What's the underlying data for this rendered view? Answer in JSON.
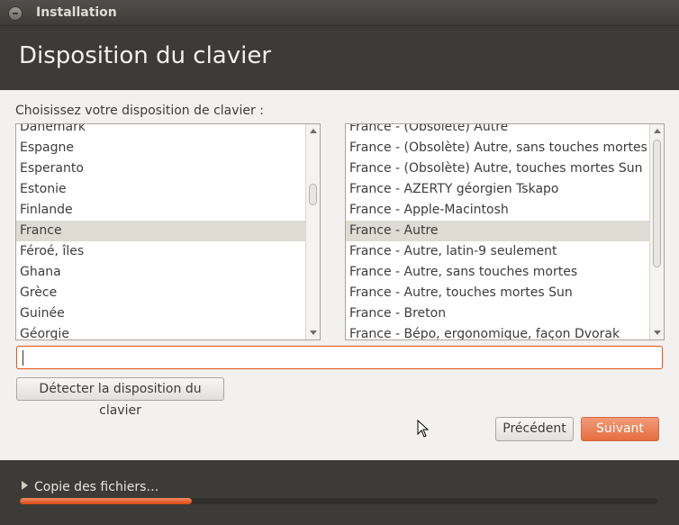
{
  "window": {
    "title": "Installation"
  },
  "header": {
    "title": "Disposition du clavier"
  },
  "prompt": "Choisissez votre disposition de clavier :",
  "layouts": [
    {
      "label": "Danemark",
      "selected": false
    },
    {
      "label": "Espagne",
      "selected": false
    },
    {
      "label": "Esperanto",
      "selected": false
    },
    {
      "label": "Estonie",
      "selected": false
    },
    {
      "label": "Finlande",
      "selected": false
    },
    {
      "label": "France",
      "selected": true
    },
    {
      "label": "Féroé, îles",
      "selected": false
    },
    {
      "label": "Ghana",
      "selected": false
    },
    {
      "label": "Grèce",
      "selected": false
    },
    {
      "label": "Guinée",
      "selected": false
    },
    {
      "label": "Géorgie",
      "selected": false
    }
  ],
  "variants": [
    {
      "label": "France - (Obsolète) Autre",
      "selected": false
    },
    {
      "label": "France - (Obsolète) Autre, sans touches mortes",
      "selected": false
    },
    {
      "label": "France - (Obsolète) Autre, touches mortes Sun",
      "selected": false
    },
    {
      "label": "France - AZERTY géorgien Tskapo",
      "selected": false
    },
    {
      "label": "France - Apple-Macintosh",
      "selected": false
    },
    {
      "label": "France - Autre",
      "selected": true
    },
    {
      "label": "France - Autre, latin-9 seulement",
      "selected": false
    },
    {
      "label": "France - Autre, sans touches mortes",
      "selected": false
    },
    {
      "label": "France - Autre, touches mortes Sun",
      "selected": false
    },
    {
      "label": "France - Breton",
      "selected": false
    },
    {
      "label": "France - Bépo, ergonomique, façon Dvorak",
      "selected": false
    }
  ],
  "test_input": {
    "value": "",
    "placeholder": ""
  },
  "buttons": {
    "detect": "Détecter la disposition du clavier",
    "previous": "Précédent",
    "next": "Suivant"
  },
  "footer": {
    "copy_label": "Copie des fichiers…",
    "progress_fraction": 0.27
  },
  "colors": {
    "accent": "#dd4814",
    "background": "#3c3b37",
    "panel": "#f2f1f0"
  }
}
